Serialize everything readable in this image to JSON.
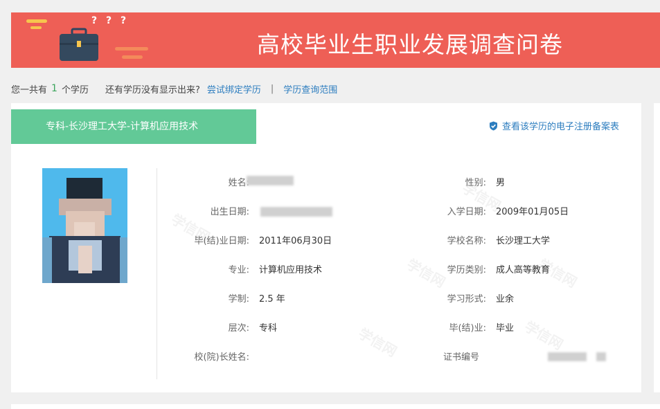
{
  "banner": {
    "title": "高校毕业生职业发展调查问卷",
    "qmarks": "? ? ?"
  },
  "topline": {
    "prefix": "您一共有",
    "count": "1",
    "suffix": "个学历",
    "prompt": "还有学历没有显示出来?",
    "bind_link": "尝试绑定学历",
    "separator": "|",
    "scope_link": "学历查询范围"
  },
  "record": {
    "title": "专科-长沙理工大学-计算机应用技术",
    "register_link": "查看该学历的电子注册备案表",
    "watermark": "学信网",
    "left_fields": [
      {
        "label": "姓名:",
        "value": ""
      },
      {
        "label": "出生日期:",
        "value": ""
      },
      {
        "label": "毕(结)业日期:",
        "value": "2011年06月30日"
      },
      {
        "label": "专业:",
        "value": "计算机应用技术"
      },
      {
        "label": "学制:",
        "value": "2.5 年"
      },
      {
        "label": "层次:",
        "value": "专科"
      },
      {
        "label": "校(院)长姓名:",
        "value": ""
      }
    ],
    "right_fields": [
      {
        "label": "性别:",
        "value": "男"
      },
      {
        "label": "入学日期:",
        "value": "2009年01月05日"
      },
      {
        "label": "学校名称:",
        "value": "长沙理工大学"
      },
      {
        "label": "学历类别:",
        "value": "成人高等教育"
      },
      {
        "label": "学习形式:",
        "value": "业余"
      },
      {
        "label": "毕(结)业:",
        "value": "毕业"
      },
      {
        "label": "证书编号",
        "value": ""
      }
    ]
  },
  "colors": {
    "banner_bg": "#ee5f56",
    "tab_bg": "#62c997",
    "link": "#2c7dbf",
    "count": "#3ba55c",
    "photo_bg": "#4fb9ec"
  },
  "icons": {
    "briefcase": "briefcase-icon",
    "shield": "shield-check-icon"
  }
}
